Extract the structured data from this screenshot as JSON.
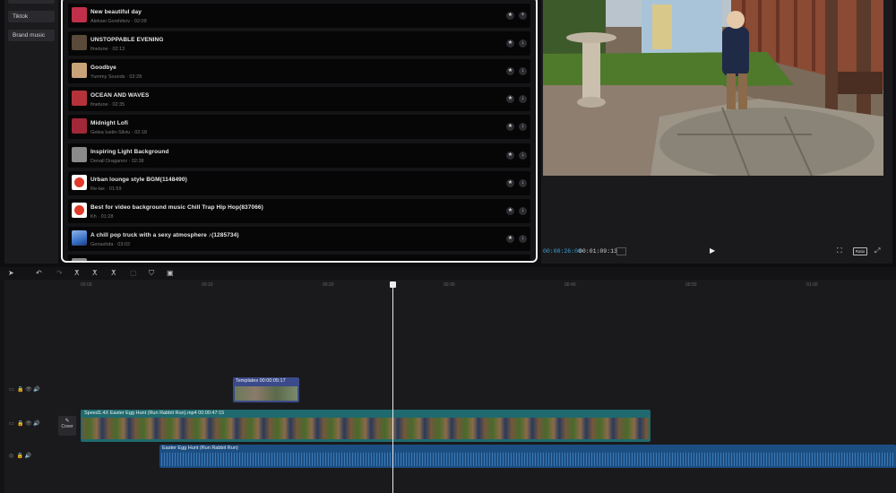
{
  "categories": [
    "Tiktok",
    "Brand music"
  ],
  "tracks": [
    {
      "title": "New beautiful day",
      "meta": "Aleksei Gorshikov · 02:09",
      "thumb": "#c0304a",
      "action": "+"
    },
    {
      "title": "UNSTOPPABLE EVENING",
      "meta": "finetune · 02:13",
      "thumb": "#5a4a3a",
      "action": "↓"
    },
    {
      "title": "Goodbye",
      "meta": "Yummy Sounds · 02:28",
      "thumb": "#caa27a",
      "action": "↓"
    },
    {
      "title": "OCEAN AND WAVES",
      "meta": "finetune · 02:35",
      "thumb": "#b6323a",
      "action": "↓"
    },
    {
      "title": "Midnight Lofi",
      "meta": "Gelea Iustin-Silviu · 02:18",
      "thumb": "#a02838",
      "action": "↓"
    },
    {
      "title": "Inspiring Light Background",
      "meta": "Denall Draganov · 02:38",
      "thumb": "#8a8a8a",
      "action": "↓"
    },
    {
      "title": "Urban lounge style BGM(1148490)",
      "meta": "Re-lax · 01:59",
      "thumb": "#e03a2a",
      "action": "↓"
    },
    {
      "title": "Best for video background music Chill Trap Hip Hop(837066)",
      "meta": "Kh · 01:28",
      "thumb": "#e03a2a",
      "action": "↓"
    },
    {
      "title": "A chill pop truck with a sexy atmosphere ♪(1285734)",
      "meta": "Genashda · 03:02",
      "thumb": "#3a72c8",
      "action": "↓"
    }
  ],
  "preview": {
    "current": "00:00:26:00",
    "total": "00:01:09:13",
    "ratio_label": "Ratio"
  },
  "ruler": [
    "00:00",
    "00:10",
    "00:20",
    "00:30",
    "00:40",
    "00:50",
    "01:00"
  ],
  "clips": {
    "template": "Templates  00:00:05:17",
    "video": "Speed1.4X  Easter Egg Hunt (Run Rabbit Run).mp4  00:00:47:15",
    "audio": "Easter Egg Hunt (Run Rabbit Run)",
    "cover": "Cover"
  }
}
